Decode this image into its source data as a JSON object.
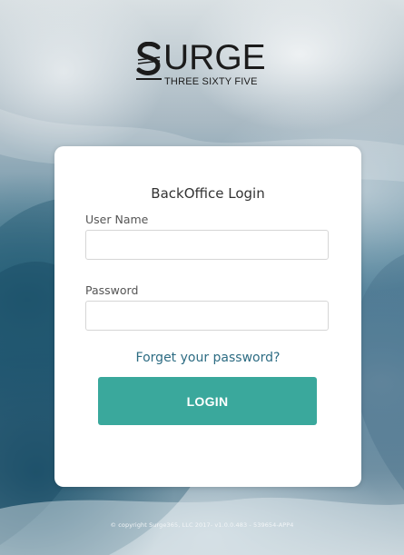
{
  "brand": {
    "logo_word": "URGE",
    "logo_sub": "THREE SIXTY FIVE"
  },
  "login": {
    "title": "BackOffice Login",
    "username_label": "User Name",
    "username_value": "",
    "password_label": "Password",
    "password_value": "",
    "forgot_link": "Forget your password?",
    "login_button": "LOGIN"
  },
  "footer": {
    "copyright": "© copyright Surge365, LLC 2017- v1.0.0.483 - 539654-APP4"
  },
  "colors": {
    "accent": "#3aa89c",
    "link": "#2d6c83",
    "card": "#ffffff"
  }
}
